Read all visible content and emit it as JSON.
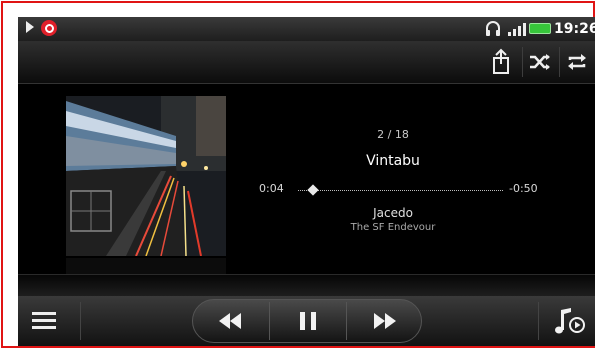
{
  "status_bar": {
    "time": "19:26",
    "icons": [
      "play-indicator-icon",
      "beats-audio-icon",
      "headset-icon",
      "signal-icon",
      "battery-icon"
    ],
    "battery_color": "#37c63b",
    "beats_color": "#e0202a"
  },
  "toolbar": {
    "icons": [
      "share-icon",
      "shuffle-icon",
      "repeat-icon"
    ]
  },
  "player": {
    "track_index": "2 / 18",
    "title": "Vintabu",
    "elapsed": "0:04",
    "remaining": "-0:50",
    "progress_fraction": 0.074,
    "artist": "Jacedo",
    "album": "The SF Endevour"
  },
  "controls": {
    "icons": [
      "menu-icon",
      "previous-icon",
      "pause-icon",
      "next-icon",
      "now-playing-list-icon"
    ]
  },
  "frame_color": "#e01414"
}
